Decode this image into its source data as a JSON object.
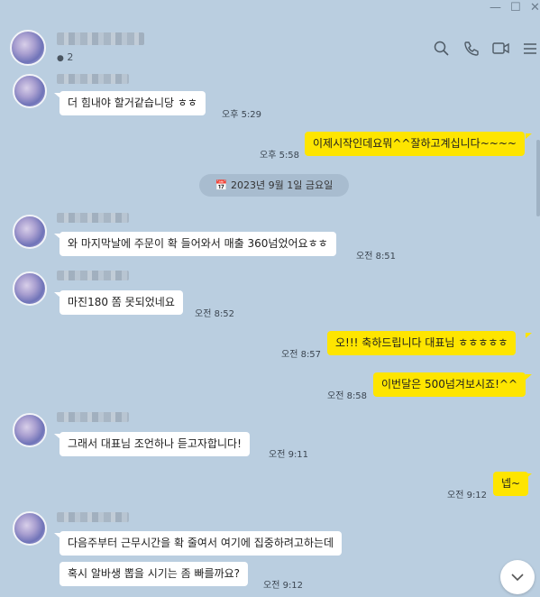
{
  "window": {
    "minimize": "—",
    "maximize": "☐",
    "close": "✕"
  },
  "header": {
    "member_count": "2",
    "icons": [
      "search-icon",
      "phone-icon",
      "video-call-icon",
      "menu-icon"
    ]
  },
  "date_divider": "2023년 9월 1일 금요일",
  "messages": [
    {
      "from": "other",
      "text": "더 힘내야 할거같습니당 ㅎㅎ",
      "time": "오후 5:29"
    },
    {
      "from": "me",
      "text": "이제시작인데요뭐^^잘하고계십니다~~~~",
      "time": "오후 5:58"
    },
    {
      "from": "other",
      "text": "와 마지막날에 주문이 확 들어와서 매출 360넘었어요ㅎㅎ",
      "time": "오전 8:51"
    },
    {
      "from": "other",
      "text": "마진180 쫌 못되었네요",
      "time": "오전 8:52"
    },
    {
      "from": "me",
      "text": "오!!! 축하드립니다 대표님 ㅎㅎㅎㅎㅎ",
      "time": "오전 8:57"
    },
    {
      "from": "me",
      "text": "이번달은 500넘겨보시죠!^^",
      "time": "오전 8:58"
    },
    {
      "from": "other",
      "text": "그래서 대표님 조언하나 듣고자합니다!",
      "time": "오전 9:11"
    },
    {
      "from": "me",
      "text": "넵~",
      "time": "오전 9:12"
    },
    {
      "from": "other",
      "text": "다음주부터 근무시간을 확 줄여서 여기에 집중하려고하는데",
      "time": ""
    },
    {
      "from": "other",
      "text": "혹시 알바생 뽑을 시기는 좀 빠를까요?",
      "time": "오전 9:12"
    }
  ],
  "scroll_down_icon": "chevron-down-icon"
}
